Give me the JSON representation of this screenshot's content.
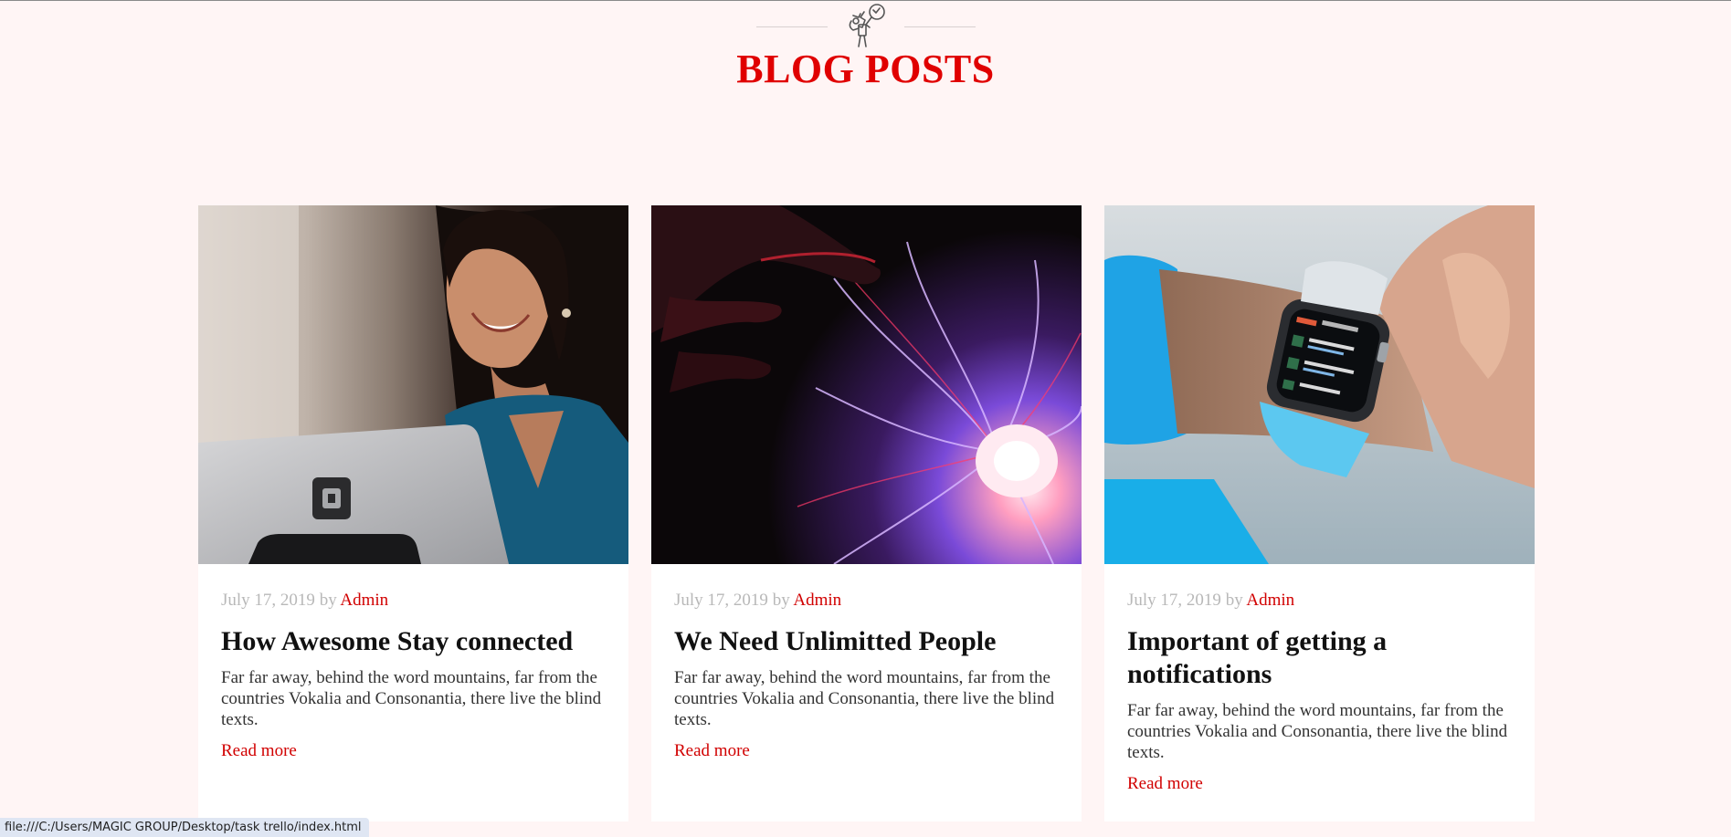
{
  "header": {
    "ornament_icon": "toy-figures-icon",
    "title": "BLOG POSTS"
  },
  "colors": {
    "accent": "#e00000",
    "background": "#fff5f5",
    "card": "#ffffff",
    "meta": "#b8b8b8"
  },
  "posts": [
    {
      "image": "woman-with-laptop-photo",
      "date": "July 17, 2019",
      "by": "by",
      "author": "Admin",
      "title": "How Awesome Stay connected",
      "excerpt": "Far far away, behind the word mountains, far from the countries Vokalia and Consonantia, there live the blind texts.",
      "read_more": "Read more"
    },
    {
      "image": "plasma-ball-photo",
      "date": "July 17, 2019",
      "by": "by",
      "author": "Admin",
      "title": "We Need Unlimitted People",
      "excerpt": "Far far away, behind the word mountains, far from the countries Vokalia and Consonantia, there live the blind texts.",
      "read_more": "Read more"
    },
    {
      "image": "smartwatch-photo",
      "date": "July 17, 2019",
      "by": "by",
      "author": "Admin",
      "title": "Important of getting a notifications",
      "excerpt": "Far far away, behind the word mountains, far from the countries Vokalia and Consonantia, there live the blind texts.",
      "read_more": "Read more"
    }
  ],
  "status_bar": {
    "url": "file:///C:/Users/MAGIC GROUP/Desktop/task trello/index.html"
  }
}
